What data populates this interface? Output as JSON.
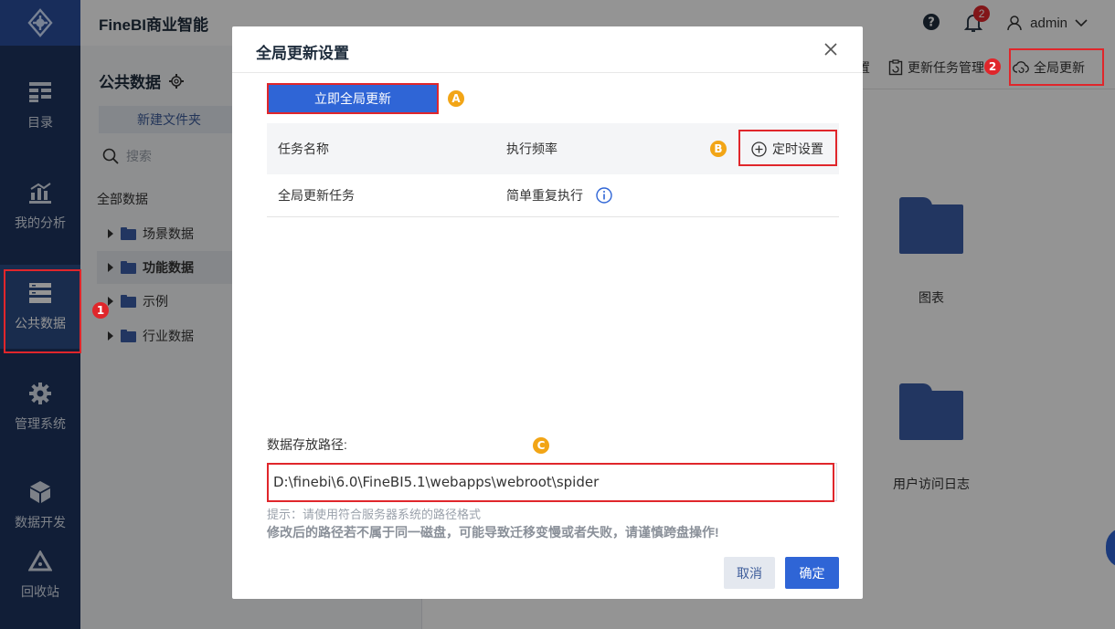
{
  "app": {
    "title": "FineBI商业智能"
  },
  "header": {
    "notification_count": "2",
    "username": "admin"
  },
  "sidebar": {
    "items": [
      {
        "label": "目录"
      },
      {
        "label": "我的分析"
      },
      {
        "label": "公共数据"
      },
      {
        "label": "管理系统"
      },
      {
        "label": "数据开发"
      },
      {
        "label": "回收站"
      }
    ]
  },
  "left_panel": {
    "title": "公共数据",
    "new_folder": "新建文件夹",
    "search_placeholder": "搜索",
    "root": "全部数据",
    "tree": [
      {
        "label": "场景数据"
      },
      {
        "label": "功能数据"
      },
      {
        "label": "示例"
      },
      {
        "label": "行业数据"
      }
    ]
  },
  "toolbar": {
    "partial_label": "置",
    "update_task_mgmt": "更新任务管理",
    "global_update": "全局更新"
  },
  "content": {
    "folders": [
      {
        "label": "图表"
      },
      {
        "label": "用户访问日志"
      }
    ]
  },
  "markers": {
    "m1": "1",
    "m2": "2",
    "ma": "A",
    "mb": "B",
    "mc": "C"
  },
  "modal": {
    "title": "全局更新设置",
    "update_now": "立即全局更新",
    "table": {
      "col_name": "任务名称",
      "col_freq": "执行频率",
      "add_schedule": "定时设置",
      "rows": [
        {
          "name": "全局更新任务",
          "freq": "简单重复执行"
        }
      ]
    },
    "path_label": "数据存放路径:",
    "path_value": "D:\\finebi\\6.0\\FineBI5.1\\webapps\\webroot\\spider",
    "hint": "提示：请使用符合服务器系统的路径格式",
    "warning": "修改后的路径若不属于同一磁盘，可能导致迁移变慢或者失败，请谨慎跨盘操作!",
    "cancel": "取消",
    "confirm": "确定"
  },
  "colors": {
    "primary": "#2f65d6",
    "sidebar": "#1e3560",
    "highlight": "#e0262b",
    "marker_yellow": "#f2a516"
  }
}
